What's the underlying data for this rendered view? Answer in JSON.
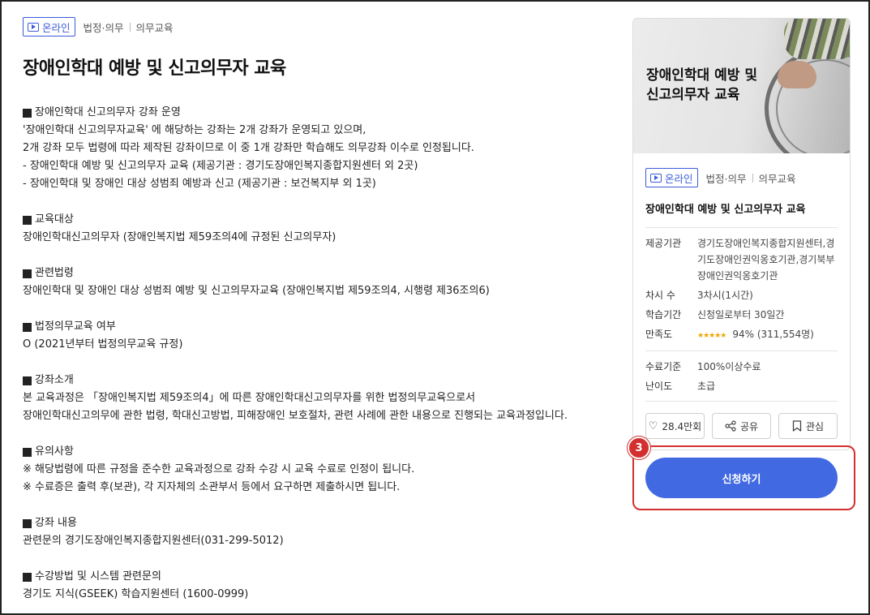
{
  "course": {
    "badge_label": "온라인",
    "category_main": "법정·의무",
    "category_sub": "의무교육",
    "title": "장애인학대 예방 및 신고의무자 교육"
  },
  "sections": [
    {
      "heading": "장애인학대 신고의무자 강좌 운영",
      "lines": [
        "'장애인학대 신고의무자교육' 에 해당하는 강좌는 2개 강좌가 운영되고 있으며,",
        "2개 강좌 모두 법령에 따라 제작된 강좌이므로 이 중 1개 강좌만 학습해도 의무강좌 이수로 인정됩니다.",
        "- 장애인학대 예방 및 신고의무자 교육 (제공기관 : 경기도장애인복지종합지원센터 외 2곳)",
        "- 장애인학대 및 장애인 대상 성범죄 예방과 신고 (제공기관 : 보건복지부 외 1곳)"
      ]
    },
    {
      "heading": "교육대상",
      "lines": [
        "장애인학대신고의무자 (장애인복지법 제59조의4에 규정된 신고의무자)"
      ]
    },
    {
      "heading": "관련법령",
      "lines": [
        "장애인학대 및 장애인 대상 성범죄 예방 및 신고의무자교육 (장애인복지법 제59조의4, 시행령 제36조의6)"
      ]
    },
    {
      "heading": "법정의무교육 여부",
      "lines": [
        "O (2021년부터 법정의무교육 규정)"
      ]
    },
    {
      "heading": "강좌소개",
      "lines": [
        "본 교육과정은 「장애인복지법 제59조의4」에 따른 장애인학대신고의무자를 위한 법정의무교육으로서",
        "장애인학대신고의무에 관한 법령, 학대신고방법, 피해장애인 보호절차, 관련 사례에 관한 내용으로 진행되는 교육과정입니다."
      ]
    },
    {
      "heading": "유의사항",
      "lines": [
        "※ 해당법령에 따른 규정을 준수한 교육과정으로 강좌 수강 시 교육 수료로 인정이 됩니다.",
        "※ 수료증은 출력 후(보관), 각 지자체의 소관부서 등에서 요구하면 제출하시면 됩니다."
      ]
    },
    {
      "heading": "강좌 내용",
      "lines": [
        "관련문의 경기도장애인복지종합지원센터(031-299-5012)"
      ]
    },
    {
      "heading": "수강방법 및 시스템 관련문의",
      "lines": [
        "경기도 지식(GSEEK) 학습지원센터 (1600-0999)"
      ]
    }
  ],
  "card": {
    "thumbnail_title_line1": "장애인학대 예방 및",
    "thumbnail_title_line2": "신고의무자 교육",
    "badge_label": "온라인",
    "category_main": "법정·의무",
    "category_sub": "의무교육",
    "title": "장애인학대 예방 및 신고의무자 교육",
    "provider_label": "제공기관",
    "provider_value": "경기도장애인복지종합지원센터,경기도장애인권익옹호기관,경기북부장애인권익옹호기관",
    "sessions_label": "차시 수",
    "sessions_value": "3차시(1시간)",
    "period_label": "학습기간",
    "period_value": "신청일로부터 30일간",
    "satisfaction_label": "만족도",
    "satisfaction_rating": 4.5,
    "satisfaction_stars": "★★★★★",
    "satisfaction_value": "94% (311,554명)",
    "completion_label": "수료기준",
    "completion_value": "100%이상수료",
    "difficulty_label": "난이도",
    "difficulty_value": "초급",
    "like_count": "28.4만회",
    "share_label": "공유",
    "bookmark_label": "관심",
    "apply_label": "신청하기"
  },
  "annotation": {
    "step_number": "3",
    "color": "#d32f2f"
  },
  "colors": {
    "accent": "#4169e1",
    "badge": "#3b5bdb",
    "star": "#f0a500"
  }
}
